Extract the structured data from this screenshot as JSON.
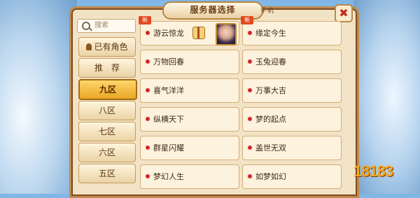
{
  "title": "服务器选择",
  "title_note": "手机",
  "close_label": "✖",
  "sidebar": {
    "search_placeholder": "搜索",
    "items": [
      {
        "label": "已有角色"
      },
      {
        "label": "推　荐"
      },
      {
        "label": "九区",
        "active": true
      },
      {
        "label": "八区"
      },
      {
        "label": "七区"
      },
      {
        "label": "六区"
      },
      {
        "label": "五区"
      }
    ]
  },
  "servers": [
    {
      "name": "游云惊龙",
      "badge": "新"
    },
    {
      "name": "缘定今生",
      "badge": "新"
    },
    {
      "name": "万物回春"
    },
    {
      "name": "玉兔迎春"
    },
    {
      "name": "喜气洋洋"
    },
    {
      "name": "万事大吉"
    },
    {
      "name": "纵横天下"
    },
    {
      "name": "梦的起点"
    },
    {
      "name": "群星闪耀"
    },
    {
      "name": "盖世无双"
    },
    {
      "name": "梦幻人生"
    },
    {
      "name": "如梦如幻"
    }
  ],
  "logo": "18183",
  "colors": {
    "accent": "#e9a725",
    "status_dot": "#d6261c"
  }
}
